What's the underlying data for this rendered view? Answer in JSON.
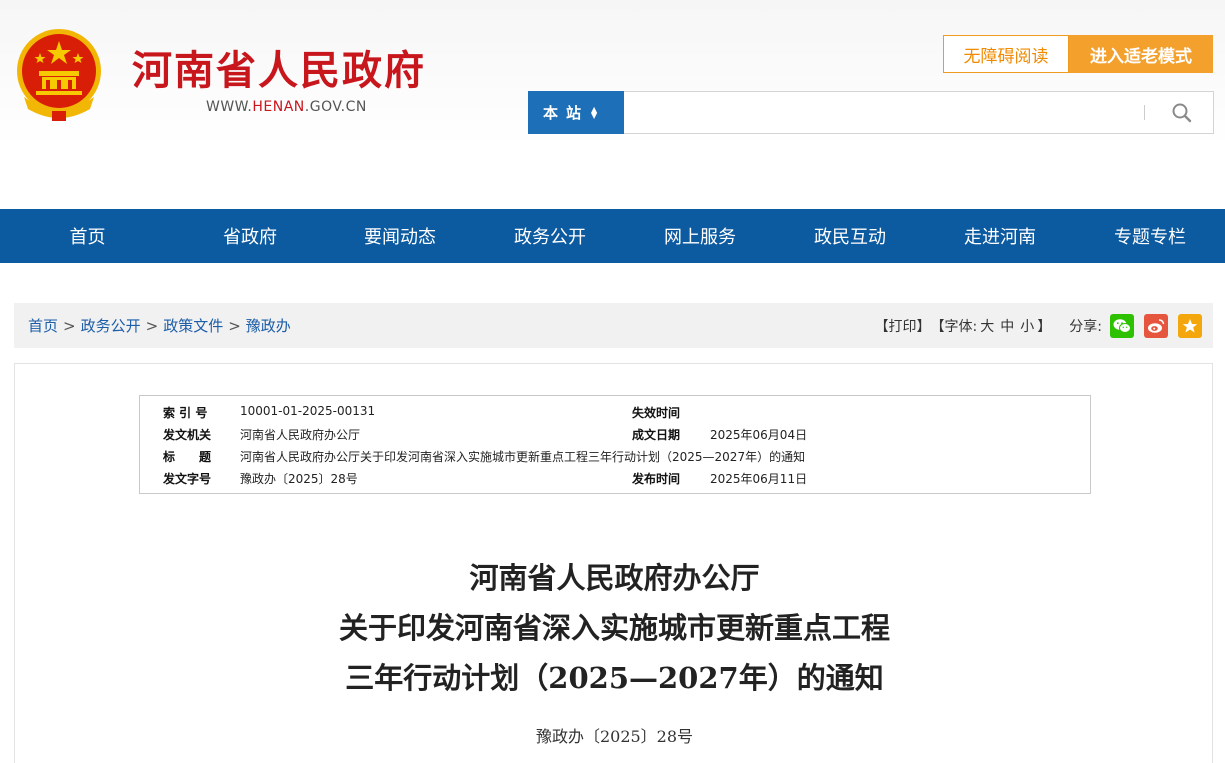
{
  "header": {
    "site_title": "河南省人民政府",
    "site_url_prefix": "WWW.",
    "site_url_domain": "HENAN",
    "site_url_suffix": ".GOV.CN",
    "accessibility_label": "无障碍阅读",
    "elder_mode_label": "进入适老模式",
    "search": {
      "scope_label": "本站",
      "placeholder": ""
    }
  },
  "nav": {
    "items": [
      "首页",
      "省政府",
      "要闻动态",
      "政务公开",
      "网上服务",
      "政民互动",
      "走进河南",
      "专题专栏"
    ]
  },
  "breadcrumb": {
    "items": [
      "首页",
      "政务公开",
      "政策文件",
      "豫政办"
    ],
    "separator": ">"
  },
  "tools": {
    "print_label": "【打印】",
    "font_label": "【字体:",
    "font_large": "大",
    "font_medium": "中",
    "font_small": "小",
    "font_close": "】",
    "share_label": "分享:"
  },
  "meta": {
    "index_label": "索 引 号",
    "index_value": "10001-01-2025-00131",
    "expire_label": "失效时间",
    "expire_value": "",
    "issuer_label": "发文机关",
    "issuer_value": "河南省人民政府办公厅",
    "created_label": "成文日期",
    "created_value": "2025年06月04日",
    "title_label": "标　　题",
    "title_value": "河南省人民政府办公厅关于印发河南省深入实施城市更新重点工程三年行动计划（2025—2027年）的通知",
    "docno_label": "发文字号",
    "docno_value": "豫政办〔2025〕28号",
    "published_label": "发布时间",
    "published_value": "2025年06月11日"
  },
  "document": {
    "title_line1": "河南省人民政府办公厅",
    "title_line2": "关于印发河南省深入实施城市更新重点工程",
    "title_line3": "三年行动计划（2025—2027年）的通知",
    "doc_number": "豫政办〔2025〕28号"
  },
  "colors": {
    "brand_red": "#c8161d",
    "nav_blue": "#0c5aa0",
    "search_blue": "#1d70b7",
    "orange": "#f4a02d",
    "wechat_green": "#2dc100",
    "weibo_red": "#e6563f",
    "star_yellow": "#f3a70d"
  }
}
